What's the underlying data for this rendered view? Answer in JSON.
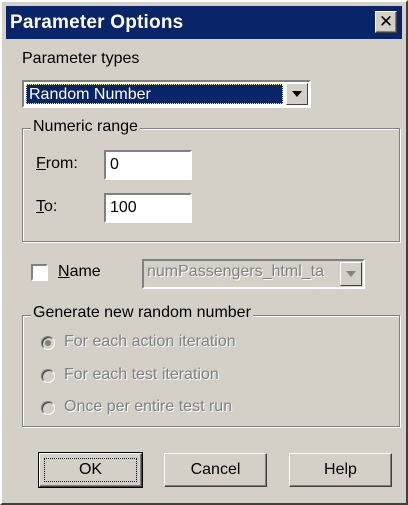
{
  "window": {
    "title": "Parameter Options",
    "close_glyph": "✕"
  },
  "parameter_types": {
    "label": "Parameter types",
    "selected": "Random Number"
  },
  "numeric_range": {
    "title": "Numeric range",
    "from_label": "From:",
    "from_value": "0",
    "to_label": "To:",
    "to_value": "100"
  },
  "name": {
    "label": "Name",
    "checked": false,
    "value": "numPassengers_html_ta"
  },
  "generate": {
    "title": "Generate new random number",
    "options": [
      {
        "label": "For each action iteration",
        "selected": true
      },
      {
        "label": "For each test iteration",
        "selected": false
      },
      {
        "label": "Once per entire test run",
        "selected": false
      }
    ]
  },
  "buttons": {
    "ok": "OK",
    "cancel": "Cancel",
    "help": "Help"
  },
  "colors": {
    "titlebar": "#0a246a",
    "face": "#d4d0c8",
    "disabled_text": "#808080"
  }
}
